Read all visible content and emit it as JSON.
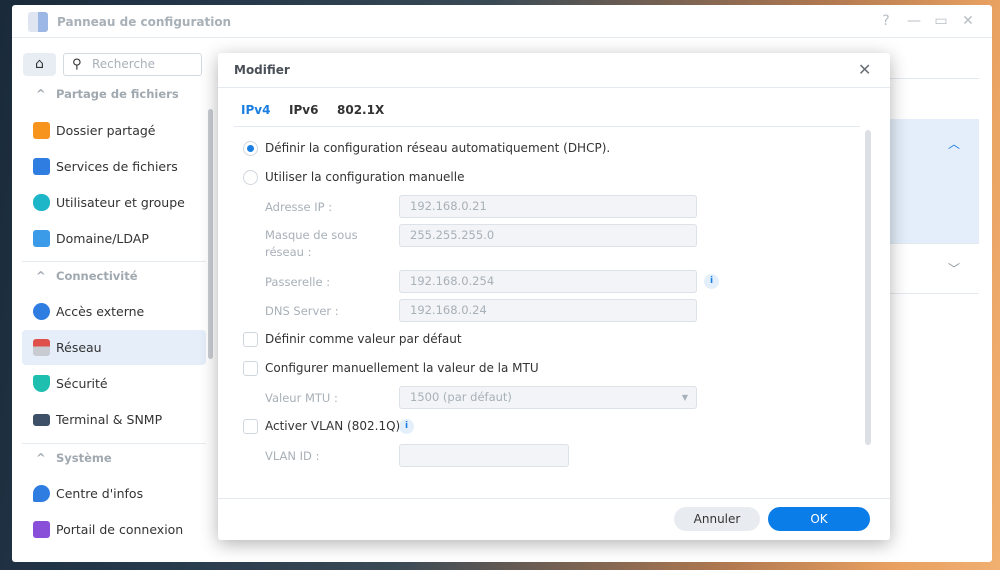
{
  "window": {
    "title": "Panneau de configuration",
    "help": "?",
    "minimize": "—",
    "maximize": "▭",
    "close": "✕"
  },
  "sidebar": {
    "home": "⌂",
    "search_placeholder": "Recherche",
    "sections": [
      {
        "label": "Partage de fichiers",
        "items": [
          {
            "label": "Dossier partagé",
            "color": "#f7941d"
          },
          {
            "label": "Services de fichiers",
            "color": "#2f7de1"
          },
          {
            "label": "Utilisateur et groupe",
            "color": "#1db6c9"
          },
          {
            "label": "Domaine/LDAP",
            "color": "#3b9be8"
          }
        ]
      },
      {
        "label": "Connectivité",
        "items": [
          {
            "label": "Accès externe",
            "color": "#2f7de1"
          },
          {
            "label": "Réseau",
            "color": "#e0504a",
            "active": true
          },
          {
            "label": "Sécurité",
            "color": "#1fbfb0"
          },
          {
            "label": "Terminal & SNMP",
            "color": "#3d5068"
          }
        ]
      },
      {
        "label": "Système",
        "items": [
          {
            "label": "Centre d'infos",
            "color": "#2f7de1"
          },
          {
            "label": "Portail de connexion",
            "color": "#8a4fd8"
          }
        ]
      }
    ]
  },
  "dialog": {
    "title": "Modifier",
    "close": "✕",
    "tabs": [
      "IPv4",
      "IPv6",
      "802.1X"
    ],
    "dhcp_label": "Définir la configuration réseau automatiquement (DHCP).",
    "manual_label": "Utiliser la configuration manuelle",
    "fields": {
      "ip_label": "Adresse IP :",
      "ip": "192.168.0.21",
      "mask_label": "Masque de sous réseau :",
      "mask": "255.255.255.0",
      "gw_label": "Passerelle :",
      "gw": "192.168.0.254",
      "dns_label": "DNS Server :",
      "dns": "192.168.0.24"
    },
    "default_label": "Définir comme valeur par défaut",
    "mtu_check_label": "Configurer manuellement la valeur de la MTU",
    "mtu_label": "Valeur MTU :",
    "mtu_value": "1500 (par défaut)",
    "vlan_label": "Activer VLAN (802.1Q)",
    "vlan_id_label": "VLAN ID :",
    "vlan_id": "",
    "info": "i",
    "cancel": "Annuler",
    "ok": "OK"
  }
}
